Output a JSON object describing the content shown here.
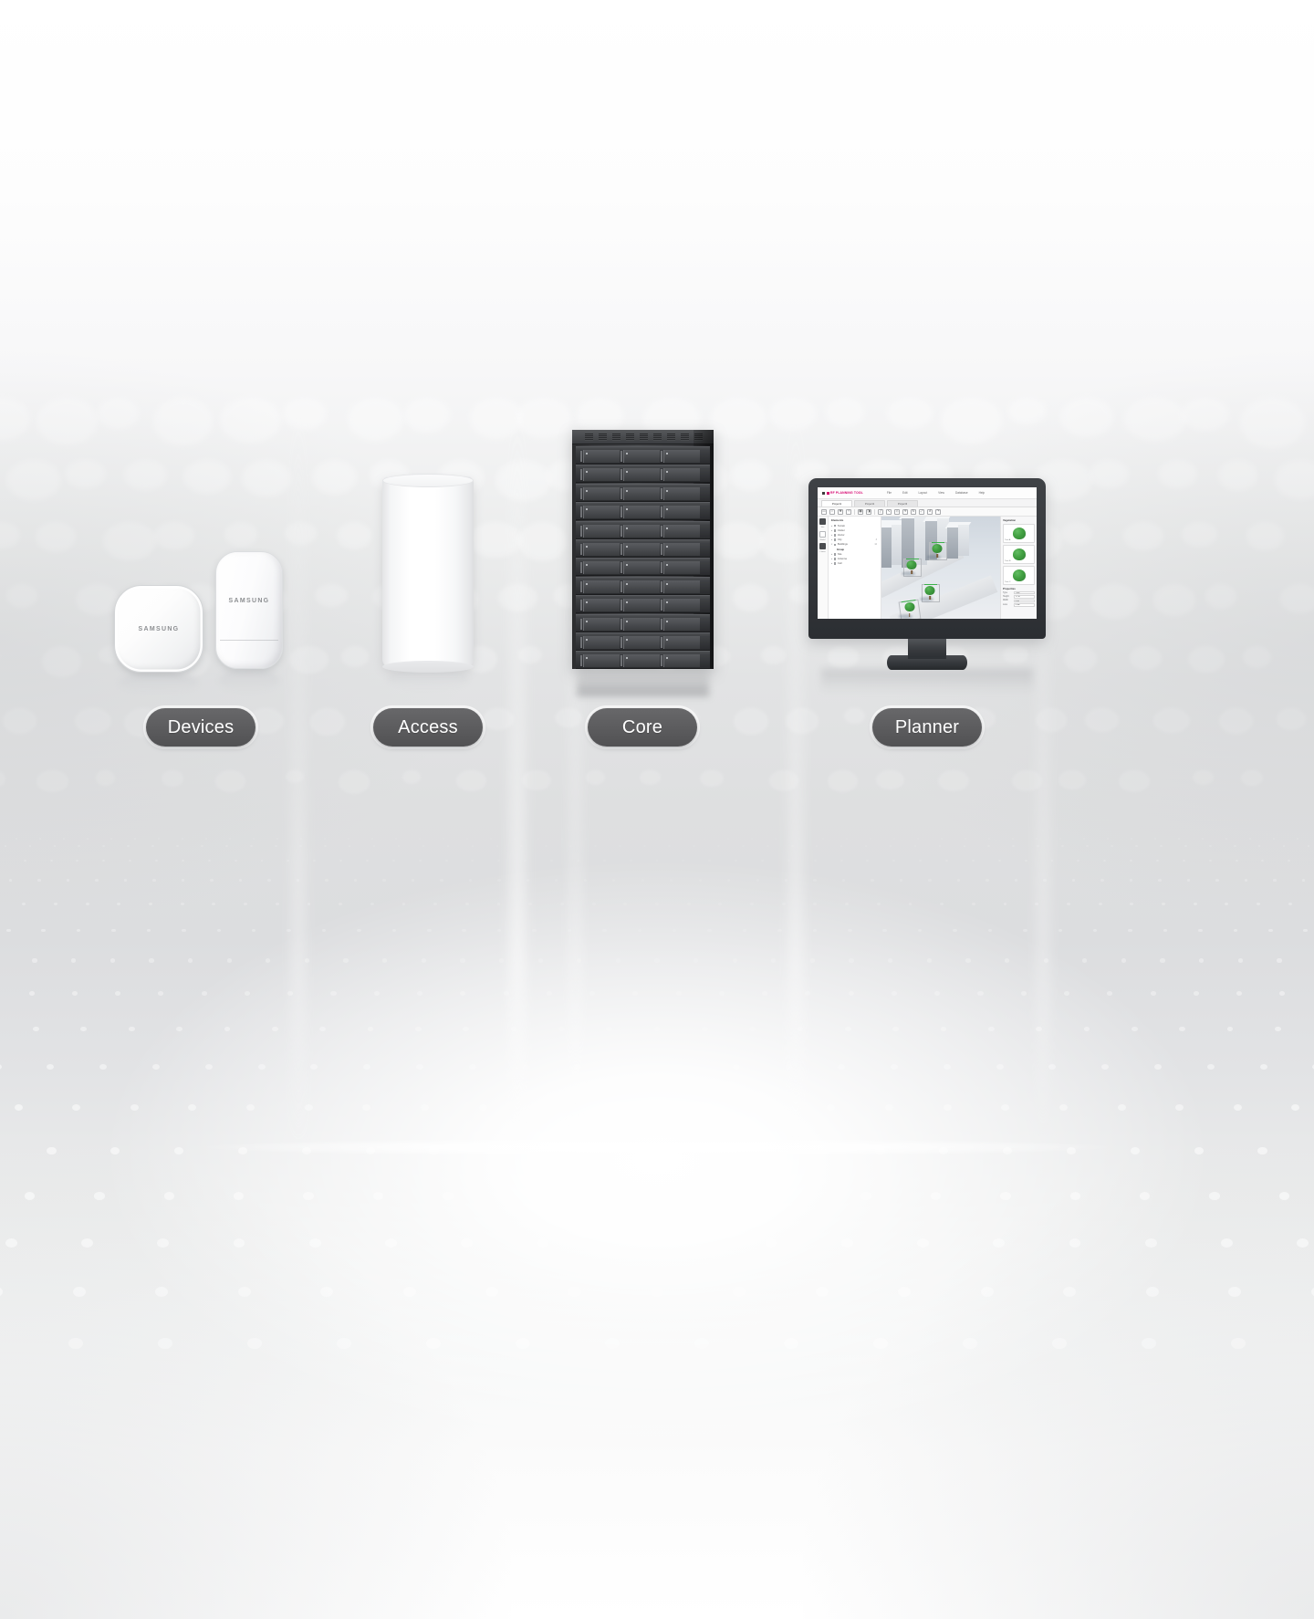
{
  "page": {
    "background_color": "#e2e3e4",
    "accent_color": "#d6006e",
    "label_color": "#5c5c5e"
  },
  "products": [
    {
      "id": "devices",
      "label": "Devices",
      "brand": "SAMSUNG",
      "items": [
        "square-access-point",
        "tall-access-point"
      ]
    },
    {
      "id": "access",
      "label": "Access",
      "items": [
        "cylinder-access-unit"
      ]
    },
    {
      "id": "core",
      "label": "Core",
      "items": [
        "server-rack"
      ]
    },
    {
      "id": "planner",
      "label": "Planner",
      "items": [
        "desktop-monitor"
      ]
    }
  ],
  "planner_app": {
    "logo_text": "RF PLANNING TOOL",
    "menu": [
      "File",
      "Edit",
      "Layout",
      "View",
      "Database",
      "Help"
    ],
    "tabs": [
      {
        "label": "Project1",
        "active": true
      },
      {
        "label": "Project2",
        "active": false
      },
      {
        "label": "Project3",
        "active": false
      }
    ],
    "toolbar_icons": [
      "select-icon",
      "zoom-icon",
      "pan-icon",
      "measure-icon",
      "grid-icon",
      "layers-icon",
      "settings-icon",
      "print-icon",
      "line-icon",
      "curve-icon",
      "polygon-icon",
      "move-icon",
      "rotate-icon",
      "scale-icon",
      "link-icon",
      "node-icon",
      "undo-icon",
      "redo-icon"
    ],
    "icon_strip": [
      {
        "icon": "site-icon",
        "caption": "Site"
      },
      {
        "icon": "model-icon",
        "caption": "Model"
      },
      {
        "icon": "clutter-icon",
        "caption": "Clutter"
      }
    ],
    "tree": {
      "header": "Elements",
      "rows": [
        {
          "label": "Terrain",
          "count": ""
        },
        {
          "label": "Clutter",
          "count": ""
        },
        {
          "label": "Vector",
          "count": ""
        },
        {
          "label": "City",
          "count": "3"
        },
        {
          "label": "Buildings",
          "count": "12"
        },
        {
          "label": "Group",
          "count": "",
          "group": true
        },
        {
          "label": "Site",
          "count": ""
        },
        {
          "label": "Antenna",
          "count": ""
        },
        {
          "label": "Cell",
          "count": ""
        }
      ]
    },
    "library": {
      "header": "Vegetation",
      "cards": [
        {
          "name": "Tree A"
        },
        {
          "name": "Tree B"
        },
        {
          "name": "Tree C"
        }
      ],
      "properties_header": "Properties",
      "properties": [
        {
          "label": "Type",
          "value": "Tree"
        },
        {
          "label": "Height",
          "value": "12 m"
        },
        {
          "label": "Width",
          "value": "6 m"
        },
        {
          "label": "Loss",
          "value": "4 dB"
        }
      ]
    },
    "viewport": {
      "scene": "3d-city-model",
      "selected_objects": 4
    }
  }
}
